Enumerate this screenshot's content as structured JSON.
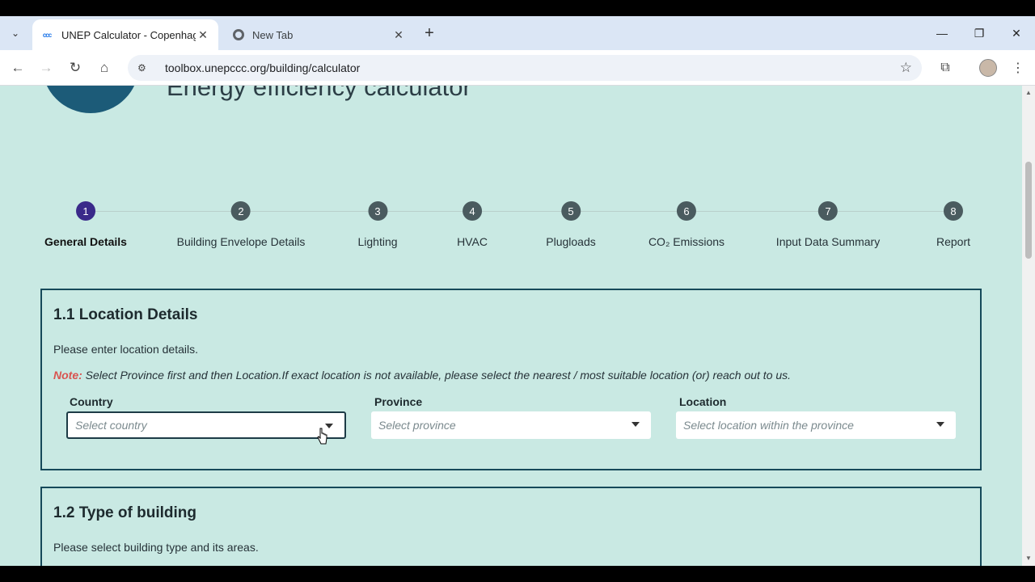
{
  "browser": {
    "tabs": [
      {
        "title": "UNEP Calculator - Copenhagen",
        "favicon": "ccc"
      },
      {
        "title": "New Tab"
      }
    ],
    "url": "toolbox.unepccc.org/building/calculator"
  },
  "page": {
    "heading": "Energy efficiency calculator",
    "steps": [
      {
        "num": "1",
        "label": "General Details"
      },
      {
        "num": "2",
        "label": "Building Envelope Details"
      },
      {
        "num": "3",
        "label": "Lighting"
      },
      {
        "num": "4",
        "label": "HVAC"
      },
      {
        "num": "5",
        "label": "Plugloads"
      },
      {
        "num": "6",
        "label": "CO₂ Emissions"
      },
      {
        "num": "7",
        "label": "Input Data Summary"
      },
      {
        "num": "8",
        "label": "Report"
      }
    ],
    "location": {
      "title": "1.1 Location Details",
      "description": "Please enter location details.",
      "note_label": "Note:",
      "note_text": " Select Province first and then Location.If exact location is not available, please select the nearest / most suitable location (or) reach out to us.",
      "country_label": "Country",
      "country_placeholder": "Select country",
      "province_label": "Province",
      "province_placeholder": "Select province",
      "loc_label": "Location",
      "loc_placeholder": "Select location within the province"
    },
    "building_type": {
      "title": "1.2 Type of building",
      "description": "Please select building type and its areas."
    }
  },
  "colors": {
    "page_bg": "#c9e9e3",
    "card_border": "#16495a",
    "step_active": "#3a2a8a",
    "note": "#d9534f"
  }
}
